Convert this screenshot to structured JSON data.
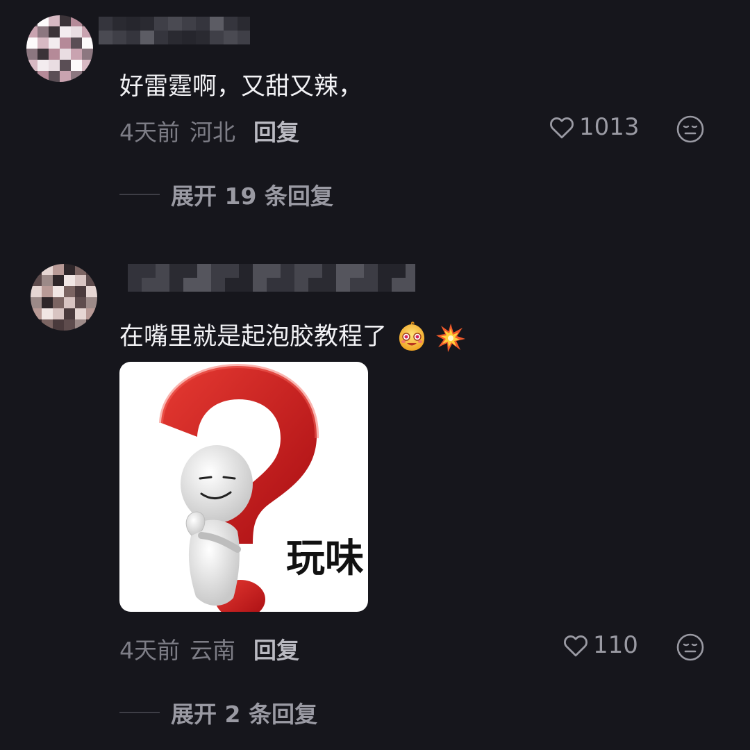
{
  "comments": [
    {
      "text": "好雷霆啊，又甜又辣，",
      "time": "4天前",
      "location": "河北",
      "reply_label": "回复",
      "likes": "1013",
      "expand_label": "展开 19 条回复"
    },
    {
      "text": "在嘴里就是起泡胶教程了",
      "emojis": [
        "drooling-face-emoji",
        "collision-emoji"
      ],
      "sticker_caption": "玩味",
      "time": "4天前",
      "location": "云南",
      "reply_label": "回复",
      "likes": "110",
      "expand_label": "展开 2 条回复"
    }
  ],
  "icons": {
    "like": "heart-outline-icon",
    "react": "emoji-face-icon"
  },
  "colors": {
    "background": "#16161c",
    "sticker_question_mark": "#c8151b"
  }
}
